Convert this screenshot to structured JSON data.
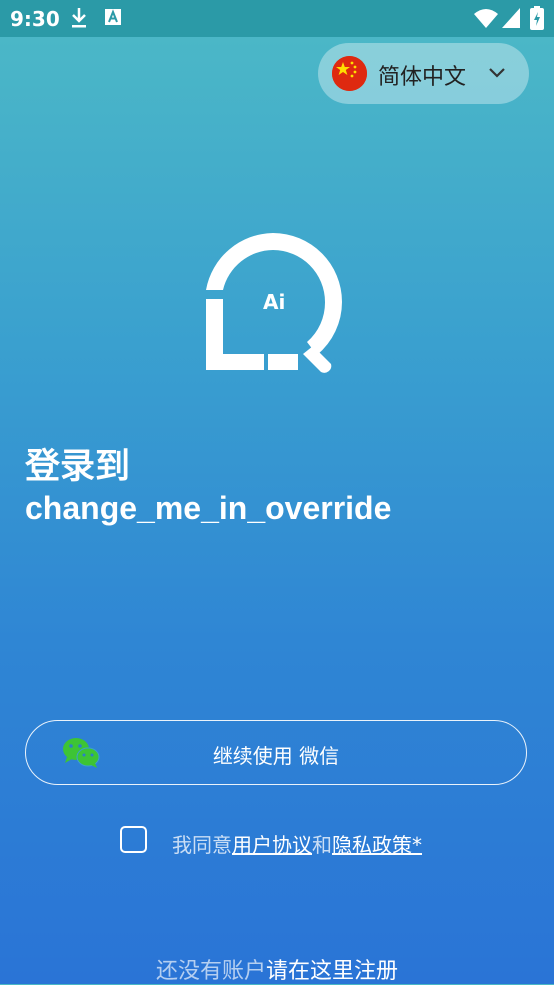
{
  "status_bar": {
    "time": "9:30"
  },
  "language": {
    "selected": "简体中文"
  },
  "logo": {
    "text": "Ai"
  },
  "title": {
    "line1": "登录到",
    "line2": "change_me_in_override"
  },
  "wechat_button": {
    "label": "继续使用 微信"
  },
  "agreement": {
    "prefix": "我同意",
    "terms_link": "用户协议",
    "and": "和",
    "privacy_link": "隐私政策*",
    "checked": false
  },
  "register": {
    "prompt": "还没有账户",
    "link": "请在这里注册"
  },
  "colors": {
    "accent_wechat": "#3dc435",
    "flag_red": "#de2910",
    "flag_star": "#ffde00"
  }
}
